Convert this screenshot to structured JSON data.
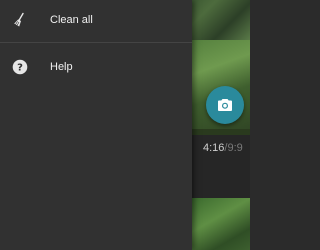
{
  "drawer": {
    "items": [
      {
        "label": "Clean all",
        "icon": "broom-icon"
      },
      {
        "label": "Help",
        "icon": "help-icon"
      }
    ]
  },
  "background": {
    "time_elapsed": "4:16",
    "time_total": "/9:9",
    "fab_icon": "camera-icon"
  },
  "colors": {
    "drawer_bg": "#313131",
    "fab": "#2a8a9c"
  }
}
